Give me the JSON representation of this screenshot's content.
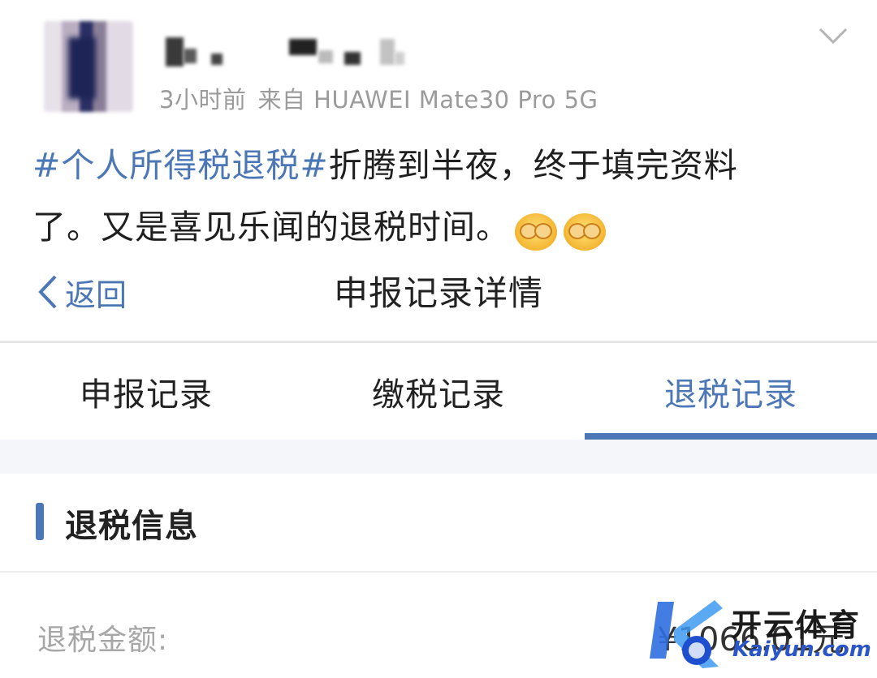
{
  "post": {
    "time": "3小时前",
    "source": "来自 HUAWEI Mate30 Pro 5G",
    "hashtag": "#个人所得税退税#",
    "text_line1": "折腾到半夜，终于填完资料",
    "text_line2": "了。又是喜见乐闻的退税时间。"
  },
  "navbar": {
    "back_label": "返回",
    "title": "申报记录详情"
  },
  "tabs": [
    {
      "label": "申报记录",
      "active": false
    },
    {
      "label": "缴税记录",
      "active": false
    },
    {
      "label": "退税记录",
      "active": true
    }
  ],
  "section": {
    "title": "退税信息"
  },
  "refund": {
    "amount_label": "退税金额:",
    "amount_value": "¥1066.01元"
  },
  "watermark": {
    "brand": "开云体育",
    "url": "Kaiyun.com"
  },
  "colors": {
    "accent": "#4c77b6",
    "meta_gray": "#9b9b9b",
    "label_gray": "#a7a7a7"
  },
  "icons": [
    "chevron-down-icon",
    "back-chevron-icon",
    "emoji-cover-eyes-icon"
  ]
}
